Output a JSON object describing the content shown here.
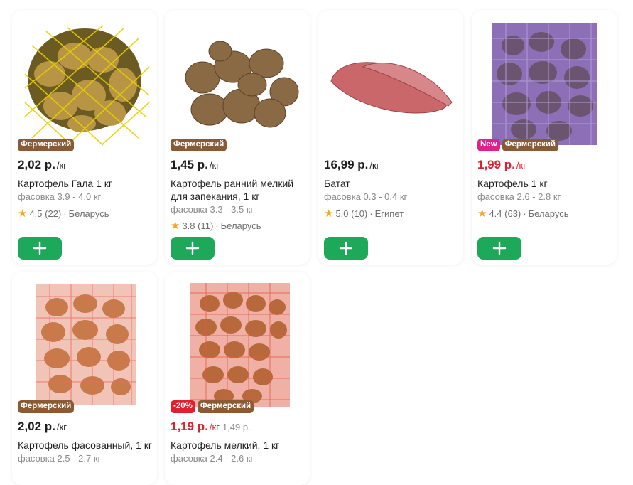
{
  "colors": {
    "accent": "#1ea85a",
    "farm_badge": "#8a5a34",
    "new_badge": "#e0218a",
    "sale": "#e01f2f"
  },
  "products": [
    {
      "badges": [
        "Фермерский"
      ],
      "price": "2,02 р.",
      "unit": "/кг",
      "title": "Картофель Гала 1 кг",
      "pack": "фасовка 3.9 - 4.0 кг",
      "rating": "4.5 (22)",
      "country": "Беларусь",
      "add_icon": "plus-icon"
    },
    {
      "badges": [
        "Фермерский"
      ],
      "price": "1,45 р.",
      "unit": "/кг",
      "title_line1": "Картофель ранний мелкий",
      "title_line2": "для запекания, 1 кг",
      "pack": "фасовка 3.3 - 3.5 кг",
      "rating": "3.8 (11)",
      "country": "Беларусь",
      "add_icon": "plus-icon"
    },
    {
      "badges": [],
      "price": "16,99 р.",
      "unit": "/кг",
      "title": "Батат",
      "pack": "фасовка 0.3 - 0.4 кг",
      "rating": "5.0 (10)",
      "country": "Египет",
      "add_icon": "plus-icon"
    },
    {
      "badges": [
        "New",
        "Фермерский"
      ],
      "price": "1,99 р.",
      "unit": "/кг",
      "title": "Картофель 1 кг",
      "pack": "фасовка 2.6 - 2.8 кг",
      "rating": "4.4 (63)",
      "country": "Беларусь",
      "add_icon": "plus-icon"
    },
    {
      "badges": [
        "Фермерский"
      ],
      "price": "2,02 р.",
      "unit": "/кг",
      "title": "Картофель фасованный, 1 кг",
      "pack": "фасовка 2.5 - 2.7 кг"
    },
    {
      "badges": [
        "-20%",
        "Фермерский"
      ],
      "price": "1,19 р.",
      "unit": "/кг",
      "old_price": "1,49 р.",
      "title": "Картофель мелкий, 1 кг",
      "pack": "фасовка 2.4 - 2.6 кг"
    }
  ]
}
